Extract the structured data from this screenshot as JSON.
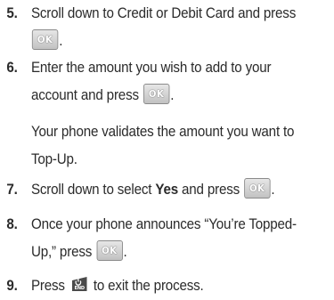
{
  "ok_key_label": "OK",
  "end_key_label": "END",
  "steps": [
    {
      "num": "5.",
      "l1": "Scroll down to Credit or Debit Card and press",
      "l2_after": "."
    },
    {
      "num": "6.",
      "l1": "Enter the amount you wish to add to your",
      "l2_before": "account and press",
      "l2_after": ".",
      "note1": "Your phone validates the amount you want to",
      "note2": "Top-Up."
    },
    {
      "num": "7.",
      "l1_before": "Scroll down to select",
      "l1_bold": "Yes",
      "l1_mid": "and press",
      "l1_after": "."
    },
    {
      "num": "8.",
      "l1": "Once your phone announces “You’re Topped-",
      "l2_before": "Up,” press",
      "l2_after": "."
    },
    {
      "num": "9.",
      "l1_before": "Press",
      "l1_after": "to exit the process."
    }
  ]
}
